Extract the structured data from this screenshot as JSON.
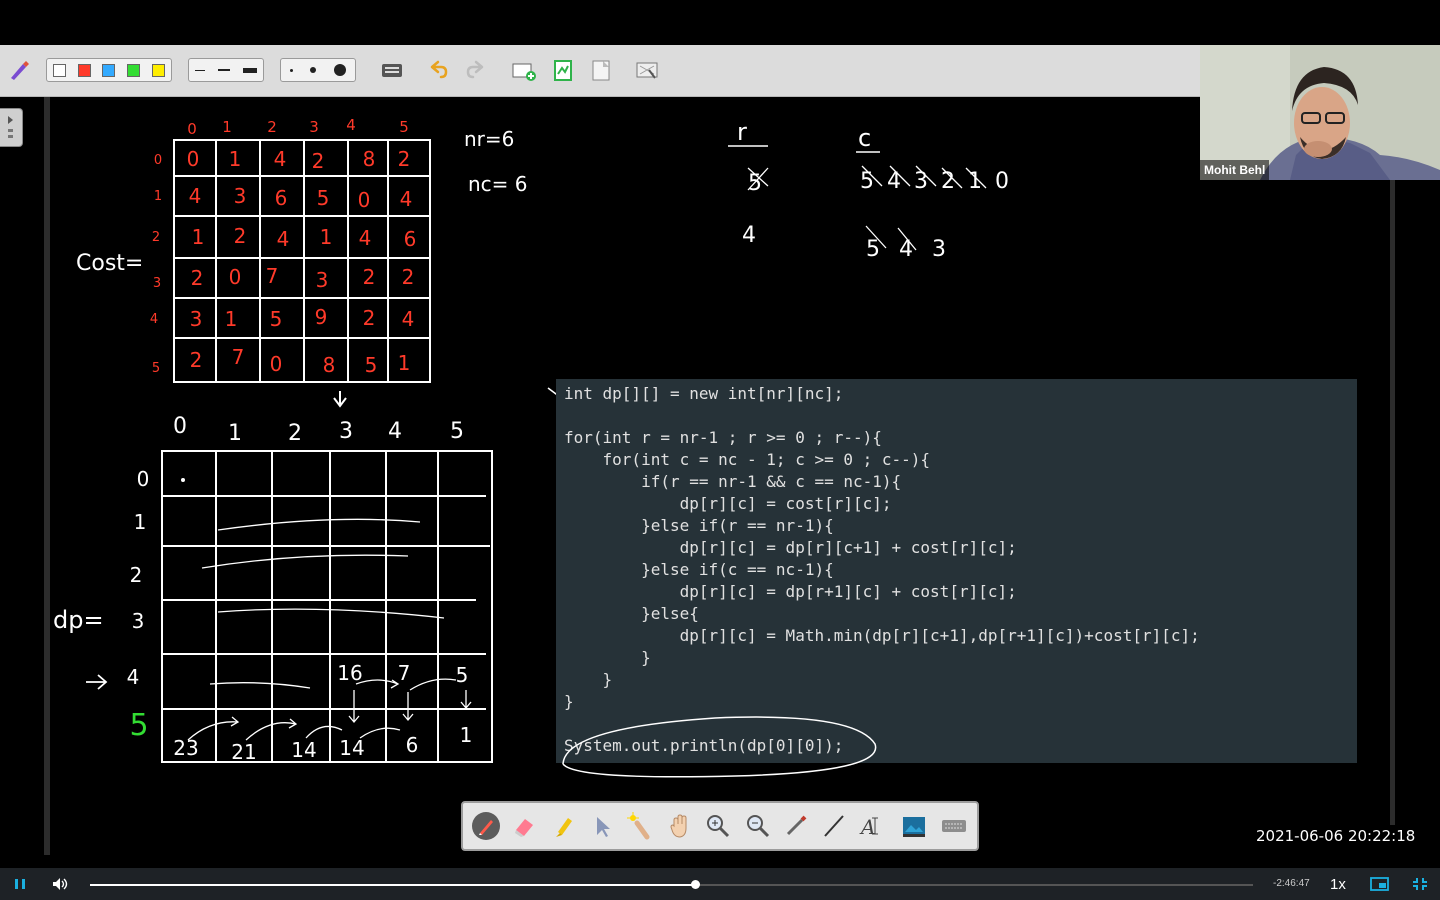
{
  "webcam": {
    "name": "Mohit Behl"
  },
  "timestamp": "2021-06-06  20:22:18",
  "player": {
    "time_remaining": "-2:46:47",
    "speed": "1x",
    "progress": 0.52
  },
  "colors": {
    "accent": "#1bb0e0",
    "ink_red": "#ff3a2a",
    "ink_white": "#ffffff",
    "ink_green": "#33dd33",
    "code_bg": "#263238"
  },
  "whiteboard": {
    "cost_label": "Cost=",
    "dp_label": "dp=",
    "nr_note": "nr=6",
    "nc_note": "nc= 6",
    "cost_col_headers": [
      "0",
      "1",
      "2",
      "3",
      "4",
      "5"
    ],
    "cost_row_headers": [
      "0",
      "1",
      "2",
      "3",
      "4",
      "5"
    ],
    "cost_matrix": [
      [
        "0",
        "1",
        "4",
        "2",
        "8",
        "2"
      ],
      [
        "4",
        "3",
        "6",
        "5",
        "0",
        "4"
      ],
      [
        "1",
        "2",
        "4",
        "1",
        "4",
        "6"
      ],
      [
        "2",
        "0",
        "7",
        "3",
        "2",
        "2"
      ],
      [
        "3",
        "1",
        "5",
        "9",
        "2",
        "4"
      ],
      [
        "2",
        "7",
        "0",
        "8",
        "5",
        "1"
      ]
    ],
    "dp_col_headers": [
      "0",
      "1",
      "2",
      "3",
      "4",
      "5"
    ],
    "dp_row_headers": [
      "0",
      "1",
      "2",
      "3",
      "4",
      "5"
    ],
    "dp_row4": [
      "",
      "",
      "",
      "16",
      "7",
      "5"
    ],
    "dp_row5": [
      "23",
      "21",
      "14",
      "14",
      "6",
      "1"
    ],
    "r_label": "r",
    "c_label": "c",
    "r_values": [
      "5",
      "4"
    ],
    "c_values_row1": "5 4 3 2 1 0",
    "c_values_row2": "5 4 3"
  },
  "code": {
    "lines": [
      "int dp[][] = new int[nr][nc];",
      "",
      "for(int r = nr-1 ; r >= 0 ; r--){",
      "    for(int c = nc - 1; c >= 0 ; c--){",
      "        if(r == nr-1 && c == nc-1){",
      "            dp[r][c] = cost[r][c];",
      "        }else if(r == nr-1){",
      "            dp[r][c] = dp[r][c+1] + cost[r][c];",
      "        }else if(c == nc-1){",
      "            dp[r][c] = dp[r+1][c] + cost[r][c];",
      "        }else{",
      "            dp[r][c] = Math.min(dp[r][c+1],dp[r+1][c])+cost[r][c];",
      "        }",
      "    }",
      "}",
      "",
      "System.out.println(dp[0][0]);"
    ]
  },
  "toolbar": {
    "pen_colors": [
      "#ffffff",
      "#ff3a2a",
      "#33aaff",
      "#33dd33",
      "#ffee00"
    ],
    "icons": [
      "pen-settings-icon",
      "line-thin-icon",
      "line-medium-icon",
      "line-thick-icon",
      "dot-small-icon",
      "dot-medium-icon",
      "dot-large-icon",
      "keyboard-icon",
      "undo-icon",
      "redo-icon",
      "add-slide-icon",
      "page-icon",
      "page-blank-icon",
      "screenshot-icon"
    ]
  },
  "drawbar": {
    "tools": [
      "pen-icon",
      "eraser-icon",
      "highlighter-icon",
      "pointer-icon",
      "laser-icon",
      "hand-icon",
      "zoom-in-icon",
      "zoom-out-icon",
      "brush-icon",
      "line-icon",
      "text-icon",
      "image-icon",
      "keyboard-icon"
    ]
  }
}
